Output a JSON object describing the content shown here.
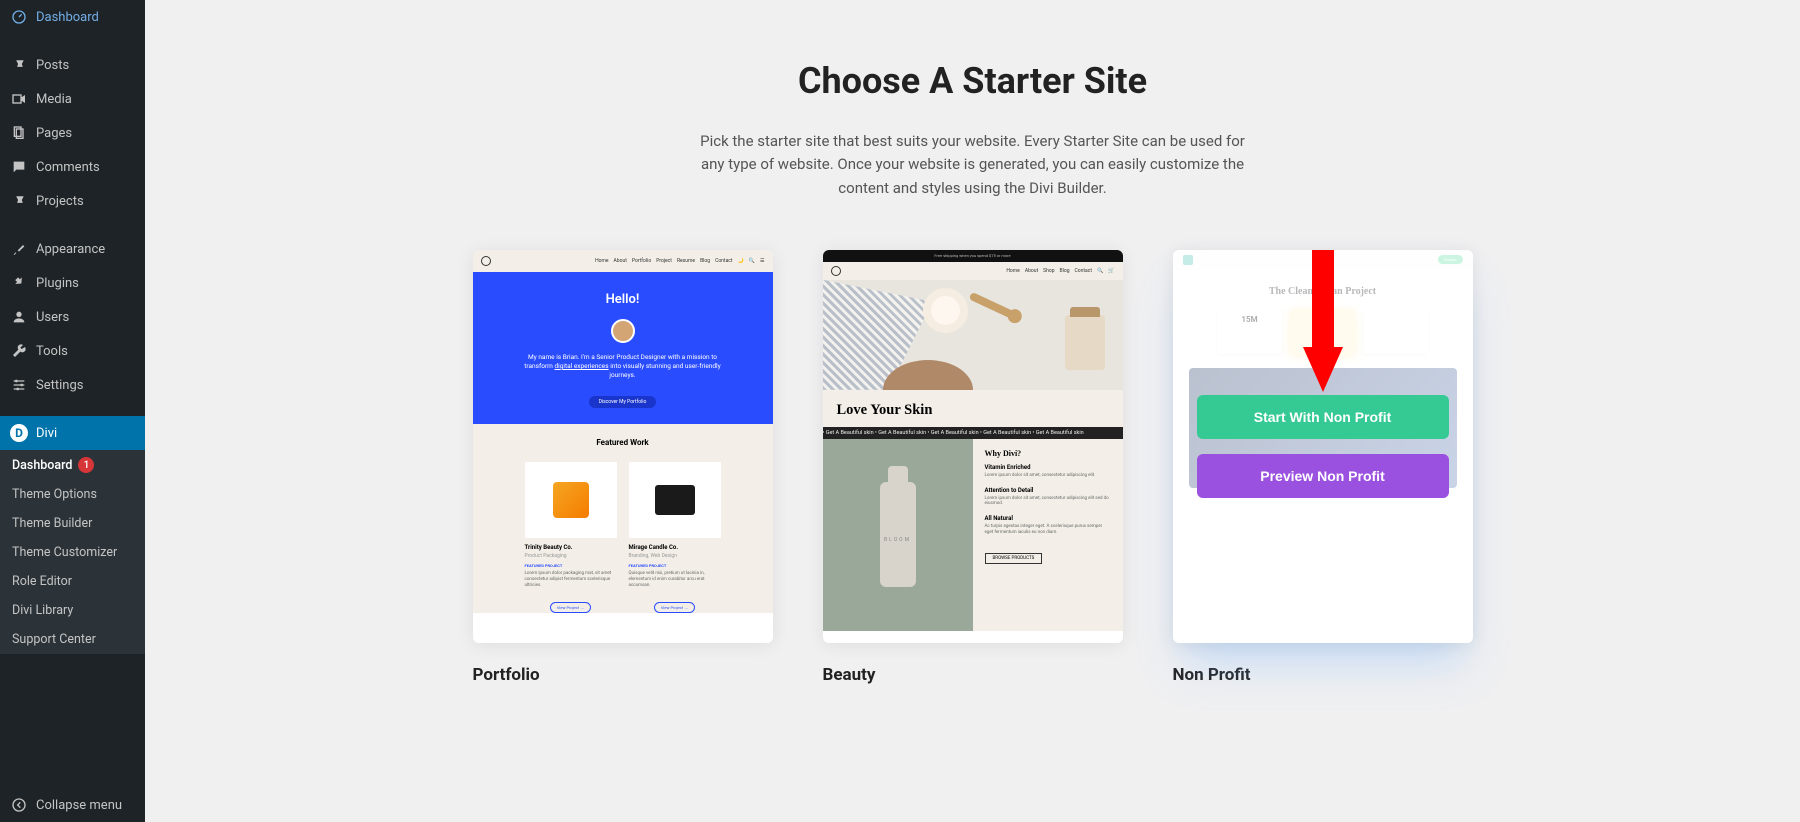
{
  "sidebar": {
    "items": [
      {
        "label": "Dashboard",
        "icon": "dashboard-icon"
      },
      {
        "label": "Posts",
        "icon": "pin-icon"
      },
      {
        "label": "Media",
        "icon": "media-icon"
      },
      {
        "label": "Pages",
        "icon": "pages-icon"
      },
      {
        "label": "Comments",
        "icon": "comment-icon"
      },
      {
        "label": "Projects",
        "icon": "pin-icon"
      },
      {
        "label": "Appearance",
        "icon": "brush-icon"
      },
      {
        "label": "Plugins",
        "icon": "plugin-icon"
      },
      {
        "label": "Users",
        "icon": "user-icon"
      },
      {
        "label": "Tools",
        "icon": "wrench-icon"
      },
      {
        "label": "Settings",
        "icon": "sliders-icon"
      },
      {
        "label": "Divi",
        "icon": "divi-icon"
      }
    ],
    "submenu": {
      "items": [
        {
          "label": "Dashboard",
          "badge": "1"
        },
        {
          "label": "Theme Options"
        },
        {
          "label": "Theme Builder"
        },
        {
          "label": "Theme Customizer"
        },
        {
          "label": "Role Editor"
        },
        {
          "label": "Divi Library"
        },
        {
          "label": "Support Center"
        }
      ]
    },
    "collapse_label": "Collapse menu"
  },
  "page": {
    "title": "Choose A Starter Site",
    "description": "Pick the starter site that best suits your website. Every Starter Site can be used for any type of website. Once your website is generated, you can easily customize the content and styles using the Divi Builder."
  },
  "cards": [
    {
      "title": "Portfolio",
      "preview": {
        "nav": [
          "Home",
          "About",
          "Portfolio",
          "Project",
          "Resume",
          "Blog",
          "Contact"
        ],
        "hello": "Hello!",
        "intro_1": "My name is Brian. I'm a Senior Product Designer with a mission to transform",
        "intro_underline": "digital experiences",
        "intro_2": " into visually stunning and user-friendly journeys.",
        "hero_btn": "Discover My Portfolio",
        "featured_title": "Featured Work",
        "works": [
          {
            "title": "Trinity Beauty Co.",
            "sub": "Product Packaging",
            "label": "FEATURED PROJECT",
            "desc": "Lorem ipsum dolor packaging mat, sit amet consectetur adipist fermentum scelerisque ultricies.",
            "btn": "View Project →"
          },
          {
            "title": "Mirage Candle Co.",
            "sub": "Branding, Web Design",
            "label": "FEATURED PROJECT",
            "desc": "Quisque velit nisi, pretium ut lacinia in, elementum id enim curabitur arcu erat accumsan.",
            "btn": "View Project →"
          }
        ]
      }
    },
    {
      "title": "Beauty",
      "preview": {
        "topbar": "Free shipping when you spend $75 or more",
        "nav": [
          "Home",
          "About",
          "Shop",
          "Blog",
          "Contact"
        ],
        "love_title": "Love Your Skin",
        "marquee": "• Get A Beautiful skin • Get A Beautiful skin • Get A Beautiful skin • Get A Beautiful skin • Get A Beautiful skin",
        "why_title": "Why Divi?",
        "bottle_label": "BLOOM",
        "features": [
          {
            "title": "Vitamin Enriched",
            "desc": "Lorem ipsum dolor sit amet, consectetur adipiscing elit."
          },
          {
            "title": "Attention to Detail",
            "desc": "Lorem ipsum dolor sit amet, consectetur adipiscing elit sed do eiusmod."
          },
          {
            "title": "All Natural",
            "desc": "Ac turpis egestas integer eget. A scelerisque purus semper eget fermentum iaculis eu non diam."
          }
        ],
        "browse": "BROWSE PRODUCTS"
      }
    },
    {
      "title": "Non Profit",
      "preview": {
        "hero_title": "The Clean Ocean Project",
        "donate": "Donate",
        "stats": [
          "15M",
          "",
          ""
        ]
      },
      "overlay": {
        "start_label": "Start With Non Profit",
        "preview_label": "Preview Non Profit"
      }
    }
  ],
  "annotation": {
    "arrow_color": "#ff0000"
  }
}
